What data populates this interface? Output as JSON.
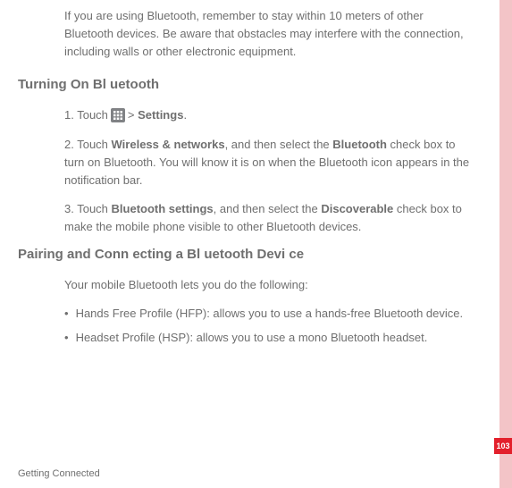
{
  "intro": "If you are using Bluetooth, remember to stay within 10 meters of other Bluetooth devices. Be aware that obstacles may interfere with the connection, including walls or other electronic equipment.",
  "heading1": "Turning On Bl uetooth",
  "step1": {
    "num": "1. Touch",
    "gt": ">",
    "settings": "Settings",
    "period": "."
  },
  "step2": {
    "prefix": "2. Touch ",
    "bold1": "Wireless & networks",
    "mid1": ", and then select the ",
    "bold2": "Bluetooth",
    "rest": " check box to turn on Bluetooth. You will know it is on when the Bluetooth icon appears in the notification bar."
  },
  "step3": {
    "prefix": "3. Touch ",
    "bold1": "Bluetooth settings",
    "mid1": ", and then select the ",
    "bold2": "Discoverable",
    "rest": " check box to make the mobile phone visible to other Bluetooth devices."
  },
  "heading2": "Pairing and Conn ecting a Bl uetooth Devi ce",
  "pairing_intro": "Your mobile Bluetooth lets you do the following:",
  "bullet1": "Hands Free Profile (HFP): allows you to use a hands-free Bluetooth device.",
  "bullet2": "Headset Profile (HSP): allows you to use a mono Bluetooth headset.",
  "footer": "Getting Connected",
  "page_number": "103"
}
